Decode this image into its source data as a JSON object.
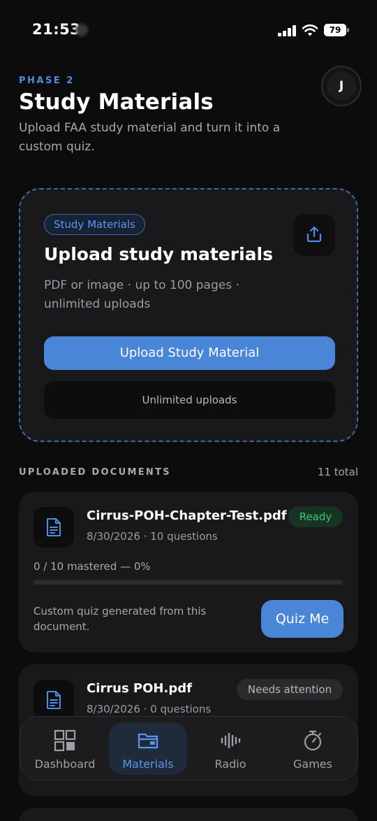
{
  "status_bar": {
    "time": "21:53",
    "battery": "79"
  },
  "header": {
    "phase": "PHASE 2",
    "title": "Study Materials",
    "subtitle": "Upload FAA study material and turn it into a custom quiz.",
    "avatar_initial": "J"
  },
  "upload_card": {
    "chip": "Study Materials",
    "title": "Upload study materials",
    "description": "PDF or image · up to 100 pages · unlimited uploads",
    "primary_button": "Upload Study Material",
    "secondary_button": "Unlimited uploads",
    "icon": "upload-icon"
  },
  "documents_section": {
    "label": "UPLOADED DOCUMENTS",
    "count": "11 total"
  },
  "documents": [
    {
      "name": "Cirrus-POH-Chapter-Test.pdf",
      "meta": "8/30/2026 · 10 questions",
      "status": "Ready",
      "progress_text": "0 / 10 mastered — 0%",
      "progress_fraction": 0,
      "description": "Custom quiz generated from this document.",
      "action": "Quiz Me"
    },
    {
      "name": "Cirrus POH.pdf",
      "meta": "8/30/2026 · 0 questions",
      "status": "Needs attention"
    }
  ],
  "tab_bar": {
    "items": [
      {
        "label": "Dashboard",
        "icon": "grid-icon"
      },
      {
        "label": "Materials",
        "icon": "folder-icon",
        "active": true
      },
      {
        "label": "Radio",
        "icon": "waveform-icon"
      },
      {
        "label": "Games",
        "icon": "stopwatch-icon"
      }
    ]
  },
  "colors": {
    "accent": "#4a86d8",
    "ready": "#3cc76e",
    "background": "#0c0c0d",
    "card": "#19191b"
  }
}
